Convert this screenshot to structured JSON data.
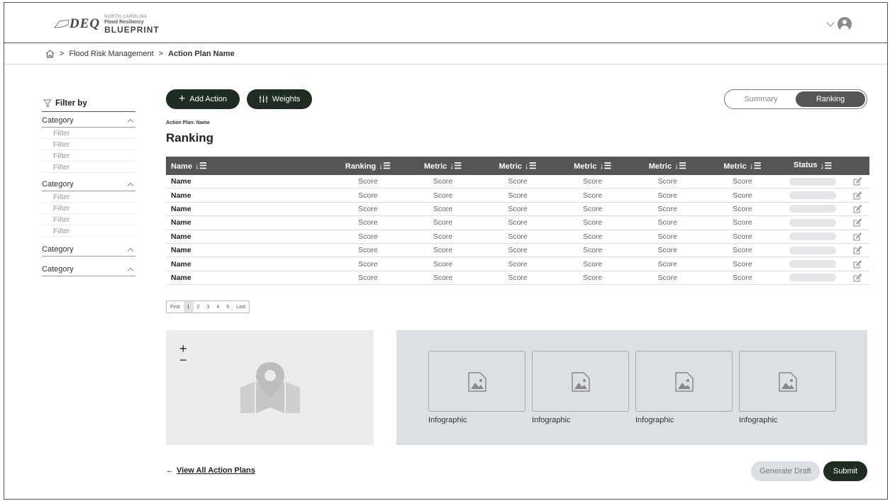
{
  "header": {
    "logo_deq": "DEQ",
    "logo_line1": "NORTH CAROLINA",
    "logo_line2": "Flood Resiliency",
    "logo_line3": "BLUEPRINT"
  },
  "breadcrumb": {
    "separator": ">",
    "items": [
      "Flood Risk Management",
      "Action Plan Name"
    ]
  },
  "sidebar": {
    "title": "Filter by",
    "groups": [
      {
        "label": "Category",
        "filters": [
          "Filter",
          "Filter",
          "Filter",
          "Filter"
        ]
      },
      {
        "label": "Category",
        "filters": [
          "Filter",
          "Filter",
          "Filter",
          "Filter"
        ]
      },
      {
        "label": "Category",
        "filters": []
      },
      {
        "label": "Category",
        "filters": []
      }
    ]
  },
  "toolbar": {
    "add_action": "Add Action",
    "weights": "Weights",
    "view_toggle": {
      "options": [
        "Summary",
        "Ranking"
      ],
      "active": "Ranking"
    }
  },
  "plan": {
    "label": "Action Plan: Name",
    "title": "Ranking"
  },
  "table": {
    "columns": [
      "Name",
      "Ranking",
      "Metric",
      "Metric",
      "Metric",
      "Metric",
      "Metric",
      "Status"
    ],
    "rows": [
      [
        "Name",
        "Score",
        "Score",
        "Score",
        "Score",
        "Score",
        "Score"
      ],
      [
        "Name",
        "Score",
        "Score",
        "Score",
        "Score",
        "Score",
        "Score"
      ],
      [
        "Name",
        "Score",
        "Score",
        "Score",
        "Score",
        "Score",
        "Score"
      ],
      [
        "Name",
        "Score",
        "Score",
        "Score",
        "Score",
        "Score",
        "Score"
      ],
      [
        "Name",
        "Score",
        "Score",
        "Score",
        "Score",
        "Score",
        "Score"
      ],
      [
        "Name",
        "Score",
        "Score",
        "Score",
        "Score",
        "Score",
        "Score"
      ],
      [
        "Name",
        "Score",
        "Score",
        "Score",
        "Score",
        "Score",
        "Score"
      ],
      [
        "Name",
        "Score",
        "Score",
        "Score",
        "Score",
        "Score",
        "Score"
      ]
    ]
  },
  "pagination": {
    "items": [
      "First",
      "1",
      "2",
      "3",
      "4",
      "5",
      "Last"
    ],
    "active": "1"
  },
  "map": {
    "zoom_in": "+",
    "zoom_out": "−"
  },
  "infographics": [
    "Infographic",
    "Infographic",
    "Infographic",
    "Infographic"
  ],
  "footer": {
    "back_arrow": "←",
    "back_link": "View All Action Plans",
    "generate_draft": "Generate Draft",
    "submit": "Submit"
  },
  "colors": {
    "primary_dark": "#1e2c22",
    "table_header": "#555555",
    "panel_gray": "#dcdfe3"
  }
}
